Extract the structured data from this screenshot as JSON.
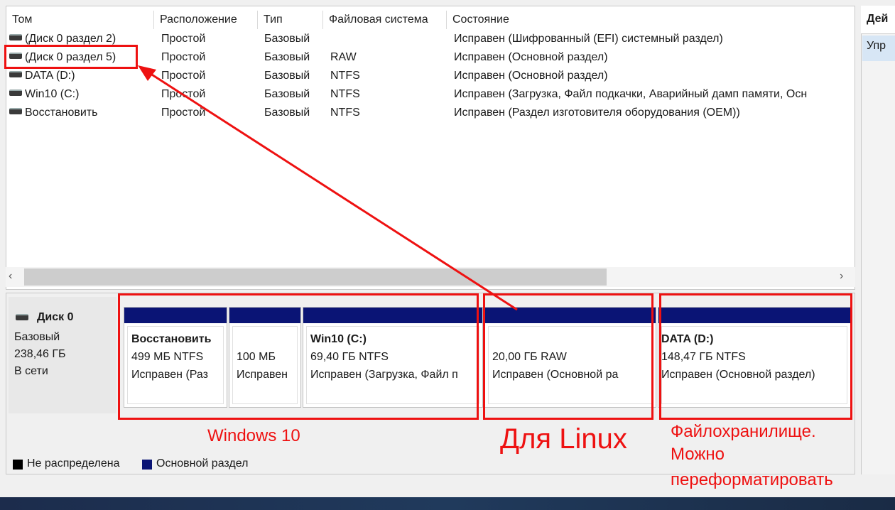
{
  "columns": [
    "Том",
    "Расположение",
    "Тип",
    "Файловая система",
    "Состояние"
  ],
  "volumes": [
    {
      "name": "(Диск 0 раздел 2)",
      "layout": "Простой",
      "type": "Базовый",
      "fs": "",
      "status": "Исправен (Шифрованный (EFI) системный раздел)"
    },
    {
      "name": "(Диск 0 раздел 5)",
      "layout": "Простой",
      "type": "Базовый",
      "fs": "RAW",
      "status": "Исправен (Основной раздел)"
    },
    {
      "name": "DATA (D:)",
      "layout": "Простой",
      "type": "Базовый",
      "fs": "NTFS",
      "status": "Исправен (Основной раздел)"
    },
    {
      "name": "Win10 (C:)",
      "layout": "Простой",
      "type": "Базовый",
      "fs": "NTFS",
      "status": "Исправен (Загрузка, Файл подкачки, Аварийный дамп памяти, Осн"
    },
    {
      "name": "Восстановить",
      "layout": "Простой",
      "type": "Базовый",
      "fs": "NTFS",
      "status": "Исправен (Раздел изготовителя оборудования (OEM))"
    }
  ],
  "actions": {
    "header": "Дей",
    "item": "Упр"
  },
  "scroll": {
    "left_arrow": "‹",
    "right_arrow": "›"
  },
  "disk": {
    "name": "Диск 0",
    "type": "Базовый",
    "size": "238,46 ГБ",
    "status": "В сети"
  },
  "partitions": [
    {
      "label": "Восстановить",
      "size": "499 МБ NTFS",
      "status": "Исправен (Раз"
    },
    {
      "label": "",
      "size": "100 МБ",
      "status": "Исправен"
    },
    {
      "label": "Win10  (C:)",
      "size": "69,40 ГБ NTFS",
      "status": "Исправен (Загрузка, Файл п"
    },
    {
      "label": "",
      "size": "20,00 ГБ RAW",
      "status": "Исправен (Основной ра"
    },
    {
      "label": "DATA  (D:)",
      "size": "148,47 ГБ NTFS",
      "status": "Исправен (Основной раздел)"
    }
  ],
  "legend": {
    "unallocated": "Не распределена",
    "primary": "Основной раздел"
  },
  "annotations": {
    "windows": "Windows 10",
    "linux": "Для Linux",
    "storage_1": "Файлохранилище.",
    "storage_2": "Можно",
    "storage_3": "переформатировать"
  },
  "colors": {
    "primary_partition": "#0a1475",
    "unallocated": "#000000",
    "annotation": "#ee1111"
  }
}
